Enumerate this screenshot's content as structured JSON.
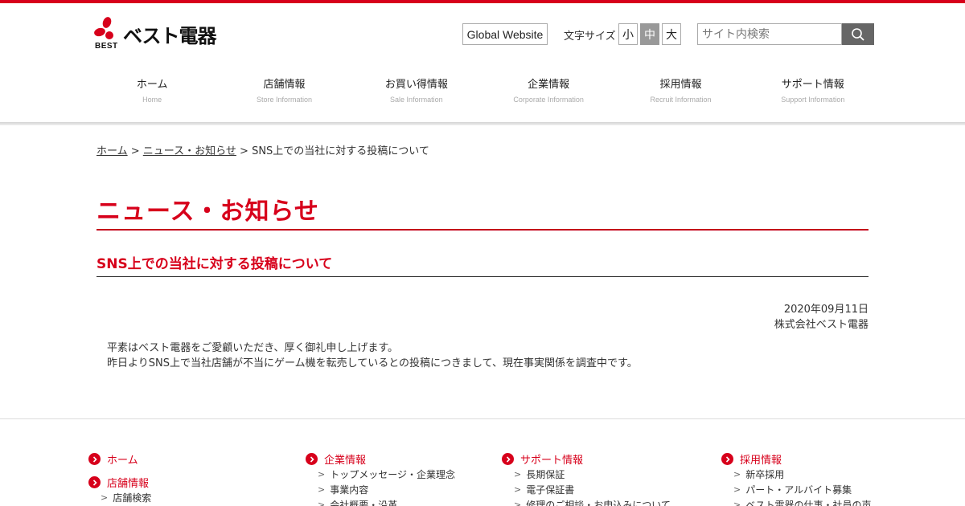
{
  "header": {
    "logo_text": "ベスト電器",
    "logo_sub": "BEST",
    "global_website": "Global Website",
    "font_size_label": "文字サイズ",
    "font_sizes": [
      "小",
      "中",
      "大"
    ],
    "font_size_active": "中",
    "search_placeholder": "サイト内検索"
  },
  "nav": [
    {
      "jp": "ホーム",
      "en": "Home"
    },
    {
      "jp": "店舗情報",
      "en": "Store Information"
    },
    {
      "jp": "お買い得情報",
      "en": "Sale Information"
    },
    {
      "jp": "企業情報",
      "en": "Corporate Information"
    },
    {
      "jp": "採用情報",
      "en": "Recruit Information"
    },
    {
      "jp": "サポート情報",
      "en": "Support Information"
    }
  ],
  "breadcrumb": {
    "home": "ホーム",
    "sep": " > ",
    "news": "ニュース・お知らせ",
    "current": "SNS上での当社に対する投稿について"
  },
  "page_title": "ニュース・お知らせ",
  "article": {
    "title": "SNS上での当社に対する投稿について",
    "date": "2020年09月11日",
    "company": "株式会社ベスト電器",
    "lines": [
      "平素はベスト電器をご愛顧いただき、厚く御礼申し上げます。",
      "昨日よりSNS上で当社店舗が不当にゲーム機を転売しているとの投稿につきまして、現在事実関係を調査中です。"
    ]
  },
  "footer": {
    "col1": {
      "home": "ホーム",
      "stores": "店舗情報",
      "stores_sub": [
        "店舗検索"
      ]
    },
    "col2": {
      "head": "企業情報",
      "sub": [
        "トップメッセージ・企業理念",
        "事業内容",
        "会社概要・沿革"
      ]
    },
    "col3": {
      "head": "サポート情報",
      "sub": [
        "長期保証",
        "電子保証書",
        "修理のご相談・お申込みについて"
      ]
    },
    "col4": {
      "head": "採用情報",
      "sub": [
        "新卒採用",
        "パート・アルバイト募集",
        "ベスト電器の仕事・社員の声"
      ]
    }
  },
  "colors": {
    "brand_red": "#d7001b"
  }
}
